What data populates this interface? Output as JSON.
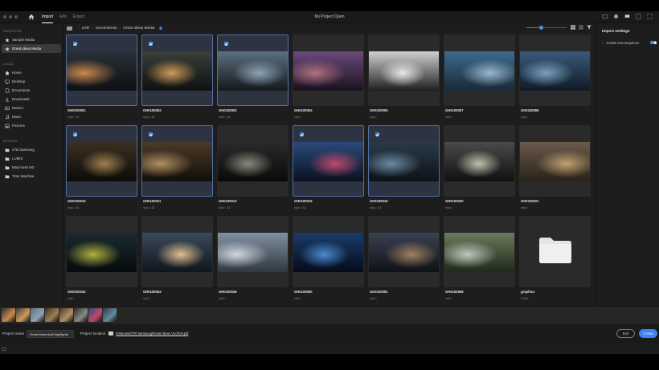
{
  "window": {
    "title": "No Project Open"
  },
  "tabs": [
    {
      "label": "Import",
      "active": true
    },
    {
      "label": "Edit",
      "active": false
    },
    {
      "label": "Export",
      "active": false
    }
  ],
  "sidebar": {
    "favorites_title": "FAVORITES",
    "favorites": [
      {
        "label": "Sample Media",
        "icon": "star-icon",
        "active": false
      },
      {
        "label": "Great Ideas Media",
        "icon": "star-icon",
        "active": true
      }
    ],
    "local_title": "LOCAL",
    "local": [
      {
        "label": "Home",
        "icon": "home-icon"
      },
      {
        "label": "Desktop",
        "icon": "desktop-icon"
      },
      {
        "label": "Documents",
        "icon": "document-icon"
      },
      {
        "label": "Downloads",
        "icon": "download-icon"
      },
      {
        "label": "Movies",
        "icon": "movie-icon"
      },
      {
        "label": "Music",
        "icon": "music-icon"
      },
      {
        "label": "Pictures",
        "icon": "picture-icon"
      }
    ],
    "devices_title": "DEVICES",
    "devices": [
      {
        "label": "2TB Samsung",
        "icon": "folder-icon"
      },
      {
        "label": "LUMIX",
        "icon": "folder-icon"
      },
      {
        "label": "Macintosh HD",
        "icon": "folder-icon"
      },
      {
        "label": "Time Machine",
        "icon": "folder-icon"
      }
    ]
  },
  "breadcrumb": [
    "LNR",
    "Screenshots",
    "Great Ideas Media"
  ],
  "zoom_level": 0.35,
  "media": [
    {
      "name": "GH0100001",
      "meta": "mp4 • :40",
      "selected": true,
      "palette": [
        "#2a3038",
        "#0d1014",
        "#c98a4a"
      ]
    },
    {
      "name": "GH0100002",
      "meta": "mp4 • :32",
      "selected": true,
      "palette": [
        "#3a3f3a",
        "#0f1210",
        "#d19a5a"
      ]
    },
    {
      "name": "GH0100003",
      "meta": "mp4 • :31",
      "selected": true,
      "palette": [
        "#5a7080",
        "#15191d",
        "#8fa3b3"
      ]
    },
    {
      "name": "GH0100004",
      "meta": "mp4 •",
      "selected": false,
      "palette": [
        "#6a4a7a",
        "#1a1220",
        "#b07080"
      ]
    },
    {
      "name": "GH0100005",
      "meta": "mp4 •",
      "selected": false,
      "palette": [
        "#d0d0d0",
        "#202020",
        "#e8e8e8"
      ]
    },
    {
      "name": "GH0100007",
      "meta": "mp4 •",
      "selected": false,
      "palette": [
        "#3e6a8a",
        "#1a2a3a",
        "#9ab8d0"
      ]
    },
    {
      "name": "GH0100008",
      "meta": "mp4 •",
      "selected": false,
      "palette": [
        "#3a5a7a",
        "#0f1a26",
        "#7aa0c0"
      ]
    },
    {
      "name": "GH0100010",
      "meta": "mp4 • :40",
      "selected": true,
      "palette": [
        "#3a3020",
        "#0d0b08",
        "#a08050"
      ]
    },
    {
      "name": "GH0100011",
      "meta": "mp4 • :32",
      "selected": true,
      "palette": [
        "#4a3a28",
        "#120e0a",
        "#b09060"
      ]
    },
    {
      "name": "GH0100012",
      "meta": "mp4 • :31",
      "selected": false,
      "palette": [
        "#2a2a2a",
        "#0a0a0a",
        "#8a8a80"
      ]
    },
    {
      "name": "GH0100015",
      "meta": "mp4 • :30",
      "selected": true,
      "palette": [
        "#2a4a7a",
        "#0a1020",
        "#c04a6a"
      ]
    },
    {
      "name": "GH0100016",
      "meta": "mp4 • :31",
      "selected": true,
      "palette": [
        "#2a3a48",
        "#0d1218",
        "#6a8aa0"
      ]
    },
    {
      "name": "GH0100020",
      "meta": "mp4 •",
      "selected": false,
      "palette": [
        "#4a4a4a",
        "#101010",
        "#c0c0b0"
      ]
    },
    {
      "name": "GH0100021",
      "meta": "mp4 •",
      "selected": false,
      "palette": [
        "#6a5a4a",
        "#2a221a",
        "#c0a070"
      ]
    },
    {
      "name": "GH0100042",
      "meta": "mp4 •",
      "selected": false,
      "palette": [
        "#1a2a30",
        "#060a0c",
        "#b0b040"
      ]
    },
    {
      "name": "GH0100044",
      "meta": "mp4 •",
      "selected": false,
      "palette": [
        "#3a4a5a",
        "#10161c",
        "#e0c090"
      ]
    },
    {
      "name": "GH0100049",
      "meta": "mp4 •",
      "selected": false,
      "palette": [
        "#8090a0",
        "#303840",
        "#d0d8e0"
      ]
    },
    {
      "name": "GH0100050",
      "meta": "mp4 •",
      "selected": false,
      "palette": [
        "#1a3a6a",
        "#060c1a",
        "#4a8ad0"
      ]
    },
    {
      "name": "GH0100051",
      "meta": "mp4 •",
      "selected": false,
      "palette": [
        "#3a4050",
        "#101218",
        "#a08060"
      ]
    },
    {
      "name": "GH0100056",
      "meta": "mp4 •",
      "selected": false,
      "palette": [
        "#6a7a5a",
        "#202a1c",
        "#c0c8c0"
      ]
    },
    {
      "name": "graphics",
      "meta": "Folder",
      "selected": false,
      "is_folder": true
    }
  ],
  "tray": [
    [
      "#2a3038",
      "#c98a4a"
    ],
    [
      "#3a3f3a",
      "#d19a5a"
    ],
    [
      "#5a7080",
      "#8fa3b3"
    ],
    [
      "#3a3020",
      "#a08050"
    ],
    [
      "#4a3a28",
      "#b09060"
    ],
    [
      "#2a2a2a",
      "#8a8a80"
    ],
    [
      "#2a4a7a",
      "#c04a6a"
    ],
    [
      "#2a3a48",
      "#6a8aa0"
    ]
  ],
  "import_settings": {
    "title": "Import settings",
    "create_new_sequence_label": "Create new sequence",
    "create_new_sequence_on": true
  },
  "project": {
    "name_label": "Project name",
    "name_value": "Great Ideas April highlights",
    "location_label": "Project location",
    "location_path": "/Volumes/2TB Samsung/Great Ideas VLOG/April"
  },
  "buttons": {
    "exit": "Exit",
    "create": "Create"
  },
  "colors": {
    "accent": "#3b82f6",
    "selection_border": "#4f6fa8"
  }
}
